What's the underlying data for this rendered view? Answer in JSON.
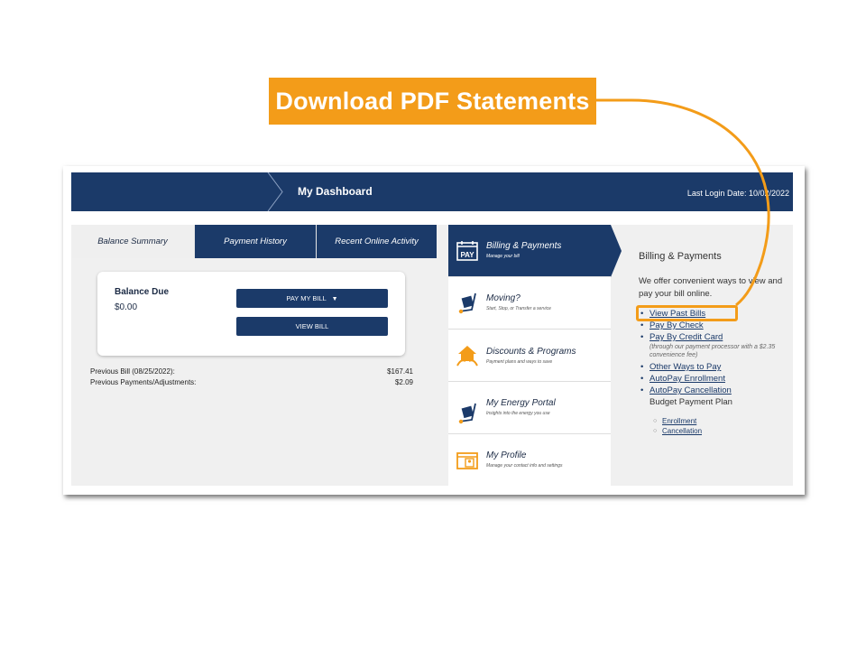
{
  "callout": {
    "text": "Download PDF Statements",
    "color": "#f39c19"
  },
  "header": {
    "title": "My Dashboard",
    "last_login": "Last Login Date: 10/02/2022"
  },
  "tabs": [
    {
      "label": "Balance Summary",
      "active": true
    },
    {
      "label": "Payment History",
      "active": false
    },
    {
      "label": "Recent Online Activity",
      "active": false
    }
  ],
  "balance": {
    "label": "Balance Due",
    "amount": "$0.00",
    "pay_button": "PAY MY BILL",
    "view_button": "VIEW BILL",
    "previous_bill_label": "Previous Bill (08/25/2022):",
    "previous_bill_value": "$167.41",
    "previous_payments_label": "Previous Payments/Adjustments:",
    "previous_payments_value": "$2.09"
  },
  "menu": [
    {
      "title": "Billing & Payments",
      "subtitle": "Manage your bill",
      "icon": "pay-calendar-icon",
      "active": true
    },
    {
      "title": "Moving?",
      "subtitle": "Start, Stop, or Transfer a service",
      "icon": "hand-truck-icon",
      "active": false
    },
    {
      "title": "Discounts & Programs",
      "subtitle": "Payment plans and ways to save",
      "icon": "house-hands-icon",
      "active": false
    },
    {
      "title": "My Energy Portal",
      "subtitle": "Insights into the energy you use",
      "icon": "hand-truck-icon",
      "active": false
    },
    {
      "title": "My Profile",
      "subtitle": "Manage your contact info and settings",
      "icon": "profile-folder-icon",
      "active": false
    }
  ],
  "right_panel": {
    "heading": "Billing & Payments",
    "intro": "We offer convenient ways to view and pay your bill online.",
    "links": {
      "view_past_bills": "View Past Bills",
      "pay_by_check": "Pay By Check",
      "pay_by_credit_card": "Pay By Credit Card",
      "credit_card_note": "(through our payment processor with a $2.35 convenience fee)",
      "other_ways": "Other Ways to Pay",
      "autopay_enrollment": "AutoPay Enrollment",
      "autopay_cancellation": "AutoPay Cancellation",
      "budget_plan": "Budget Payment Plan",
      "budget_enrollment": "Enrollment",
      "budget_cancellation": "Cancellation"
    }
  },
  "colors": {
    "navy": "#1b3a69",
    "accent": "#f39c19",
    "panel": "#f0f0f0"
  }
}
